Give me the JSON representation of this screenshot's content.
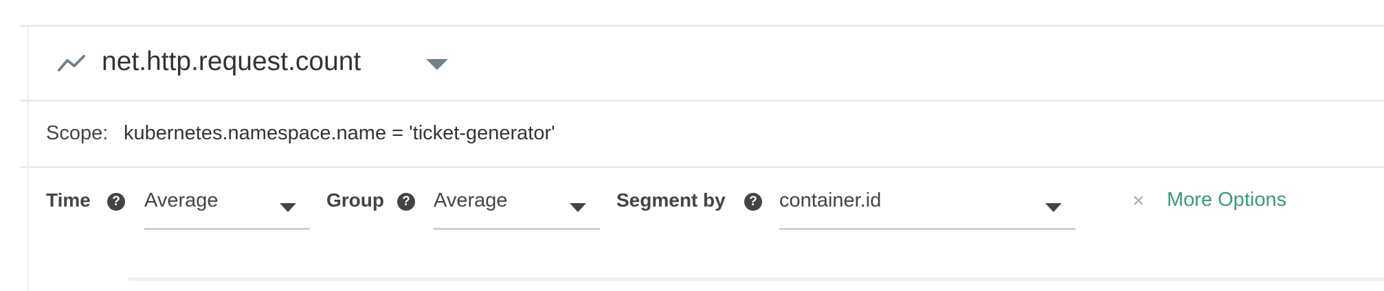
{
  "header": {
    "title": "net.http.request.count",
    "icon": "line-chart-icon"
  },
  "scope": {
    "label": "Scope:",
    "value": "kubernetes.namespace.name = 'ticket-generator'"
  },
  "controls": {
    "time": {
      "label": "Time",
      "help": "?",
      "value": "Average"
    },
    "group": {
      "label": "Group",
      "help": "?",
      "value": "Average"
    },
    "segment": {
      "label": "Segment by",
      "help": "?",
      "value": "container.id"
    },
    "clear": "×",
    "more_options": "More Options"
  },
  "colors": {
    "accent": "#3a9a78",
    "border": "#e4ecee",
    "text": "#333333"
  }
}
